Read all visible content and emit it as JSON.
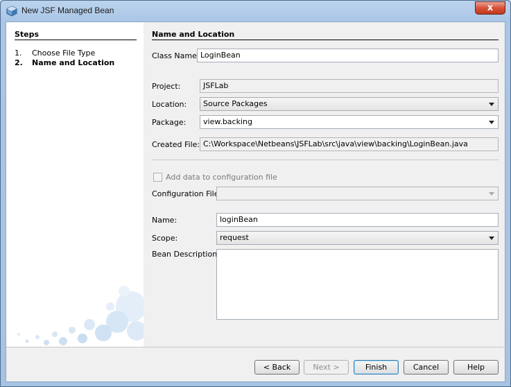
{
  "window": {
    "title": "New JSF Managed Bean",
    "close_label": "x"
  },
  "steps": {
    "title": "Steps",
    "items": [
      {
        "num": "1.",
        "label": "Choose File Type",
        "current": false
      },
      {
        "num": "2.",
        "label": "Name and Location",
        "current": true
      }
    ]
  },
  "form": {
    "section_title": "Name and Location",
    "class_name": {
      "label": "Class Name:",
      "value": "LoginBean"
    },
    "project": {
      "label": "Project:",
      "value": "JSFLab"
    },
    "location": {
      "label": "Location:",
      "value": "Source Packages"
    },
    "package": {
      "label": "Package:",
      "value": "view.backing"
    },
    "created_file": {
      "label": "Created File:",
      "value": "C:\\Workspace\\Netbeans\\JSFLab\\src\\java\\view\\backing\\LoginBean.java"
    },
    "add_config": {
      "label": "Add data to configuration file",
      "checked": false
    },
    "config_file": {
      "label": "Configuration File:",
      "value": ""
    },
    "name": {
      "label": "Name:",
      "value": "loginBean"
    },
    "scope": {
      "label": "Scope:",
      "value": "request"
    },
    "description": {
      "label": "Bean Description:",
      "value": ""
    }
  },
  "buttons": {
    "back": "< Back",
    "next": "Next >",
    "finish": "Finish",
    "cancel": "Cancel",
    "help": "Help"
  }
}
